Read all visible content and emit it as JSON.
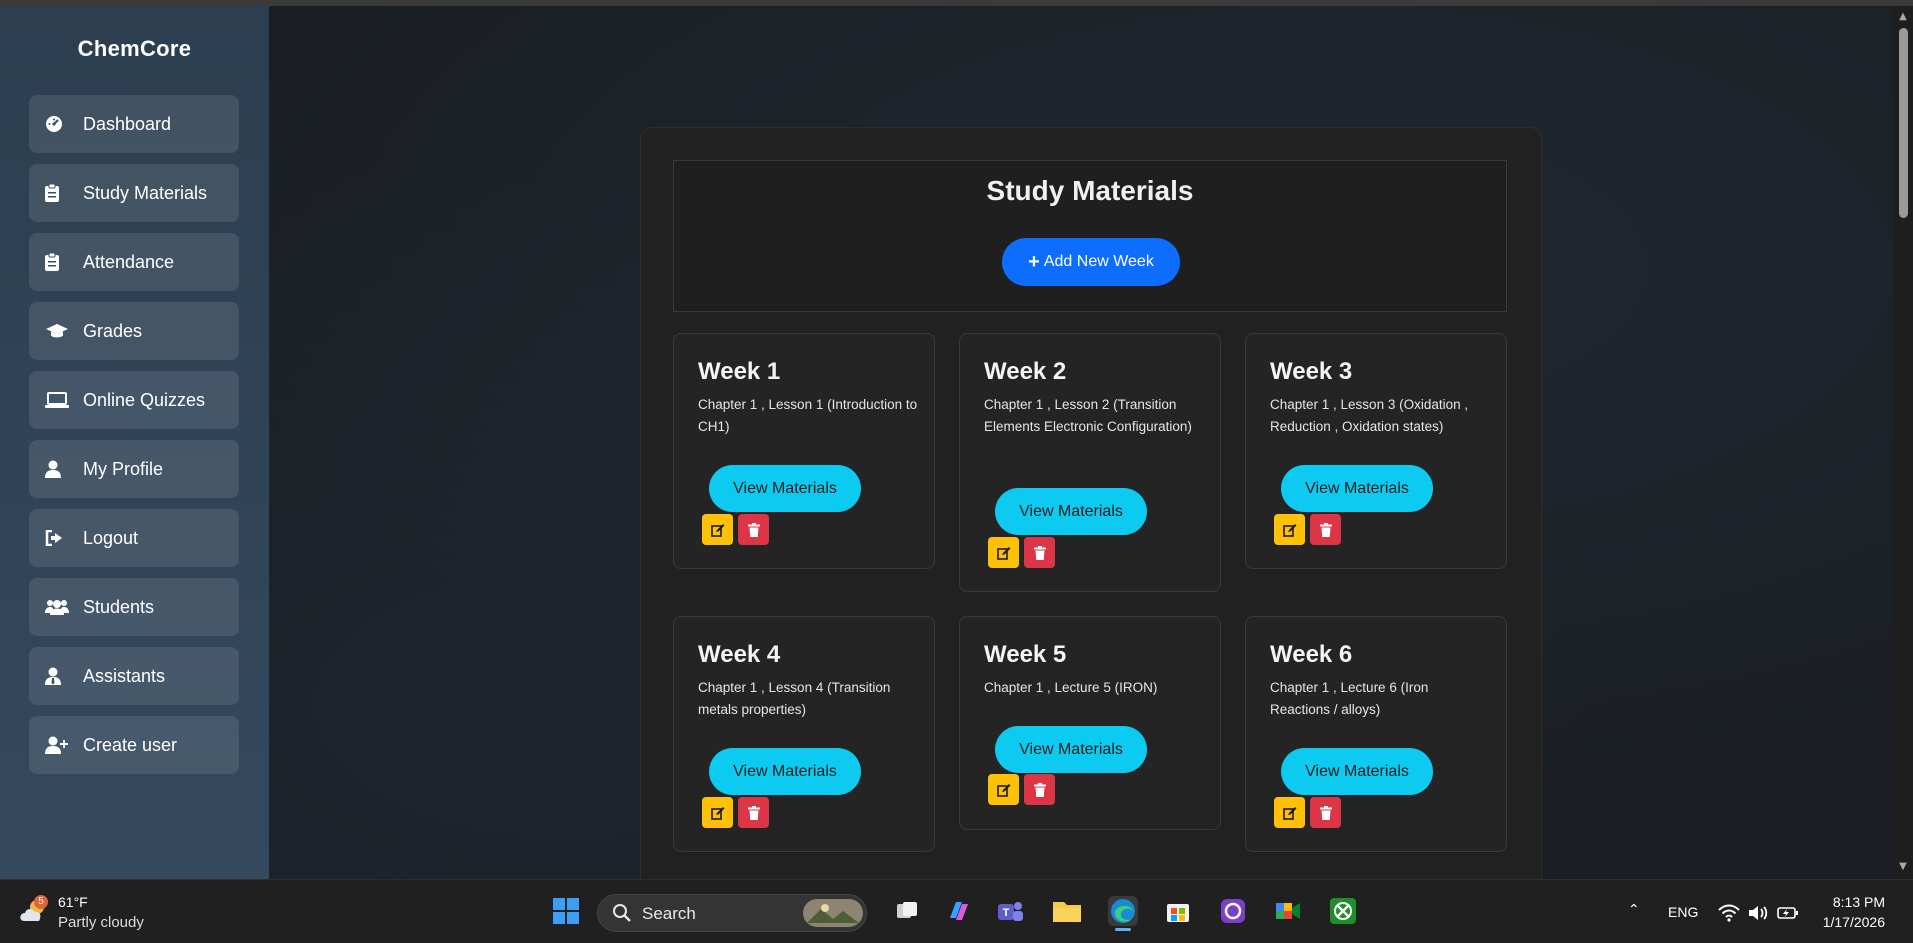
{
  "app": {
    "brand": "ChemCore",
    "nav": [
      {
        "label": "Dashboard",
        "icon": "tachometer-icon"
      },
      {
        "label": "Study Materials",
        "icon": "clipboard-icon"
      },
      {
        "label": "Attendance",
        "icon": "clipboard-icon"
      },
      {
        "label": "Grades",
        "icon": "graduation-cap-icon"
      },
      {
        "label": "Online Quizzes",
        "icon": "laptop-icon"
      },
      {
        "label": "My Profile",
        "icon": "user-icon"
      },
      {
        "label": "Logout",
        "icon": "sign-out-icon"
      },
      {
        "label": "Students",
        "icon": "users-icon"
      },
      {
        "label": "Assistants",
        "icon": "user-tie-icon"
      },
      {
        "label": "Create user",
        "icon": "user-plus-icon"
      }
    ]
  },
  "main": {
    "title": "Study Materials",
    "add_label": "Add New Week",
    "add_icon": "plus-icon",
    "view_label": "View Materials",
    "weeks": [
      {
        "title": "Week 1",
        "desc": "Chapter 1 , Lesson 1 (Introduction to CH1)"
      },
      {
        "title": "Week 2",
        "desc": "Chapter 1 , Lesson 2 (Transition Elements Electronic Configuration)"
      },
      {
        "title": "Week 3",
        "desc": "Chapter 1 , Lesson 3 (Oxidation , Reduction , Oxidation states)"
      },
      {
        "title": "Week 4",
        "desc": "Chapter 1 , Lesson 4 (Transition metals properties)"
      },
      {
        "title": "Week 5",
        "desc": "Chapter 1 , Lecture 5 (IRON)"
      },
      {
        "title": "Week 6",
        "desc": "Chapter 1 , Lecture 6 (Iron Reactions / alloys)"
      }
    ],
    "colors": {
      "primary": "#0d6efd",
      "info": "#0dcaf0",
      "warning": "#ffc107",
      "danger": "#dc3545"
    }
  },
  "taskbar": {
    "weather_temp": "61°F",
    "weather_cond": "Partly cloudy",
    "weather_badge": "5",
    "search_label": "Search",
    "lang": "ENG",
    "time": "8:13 PM",
    "date": "1/17/2026"
  }
}
